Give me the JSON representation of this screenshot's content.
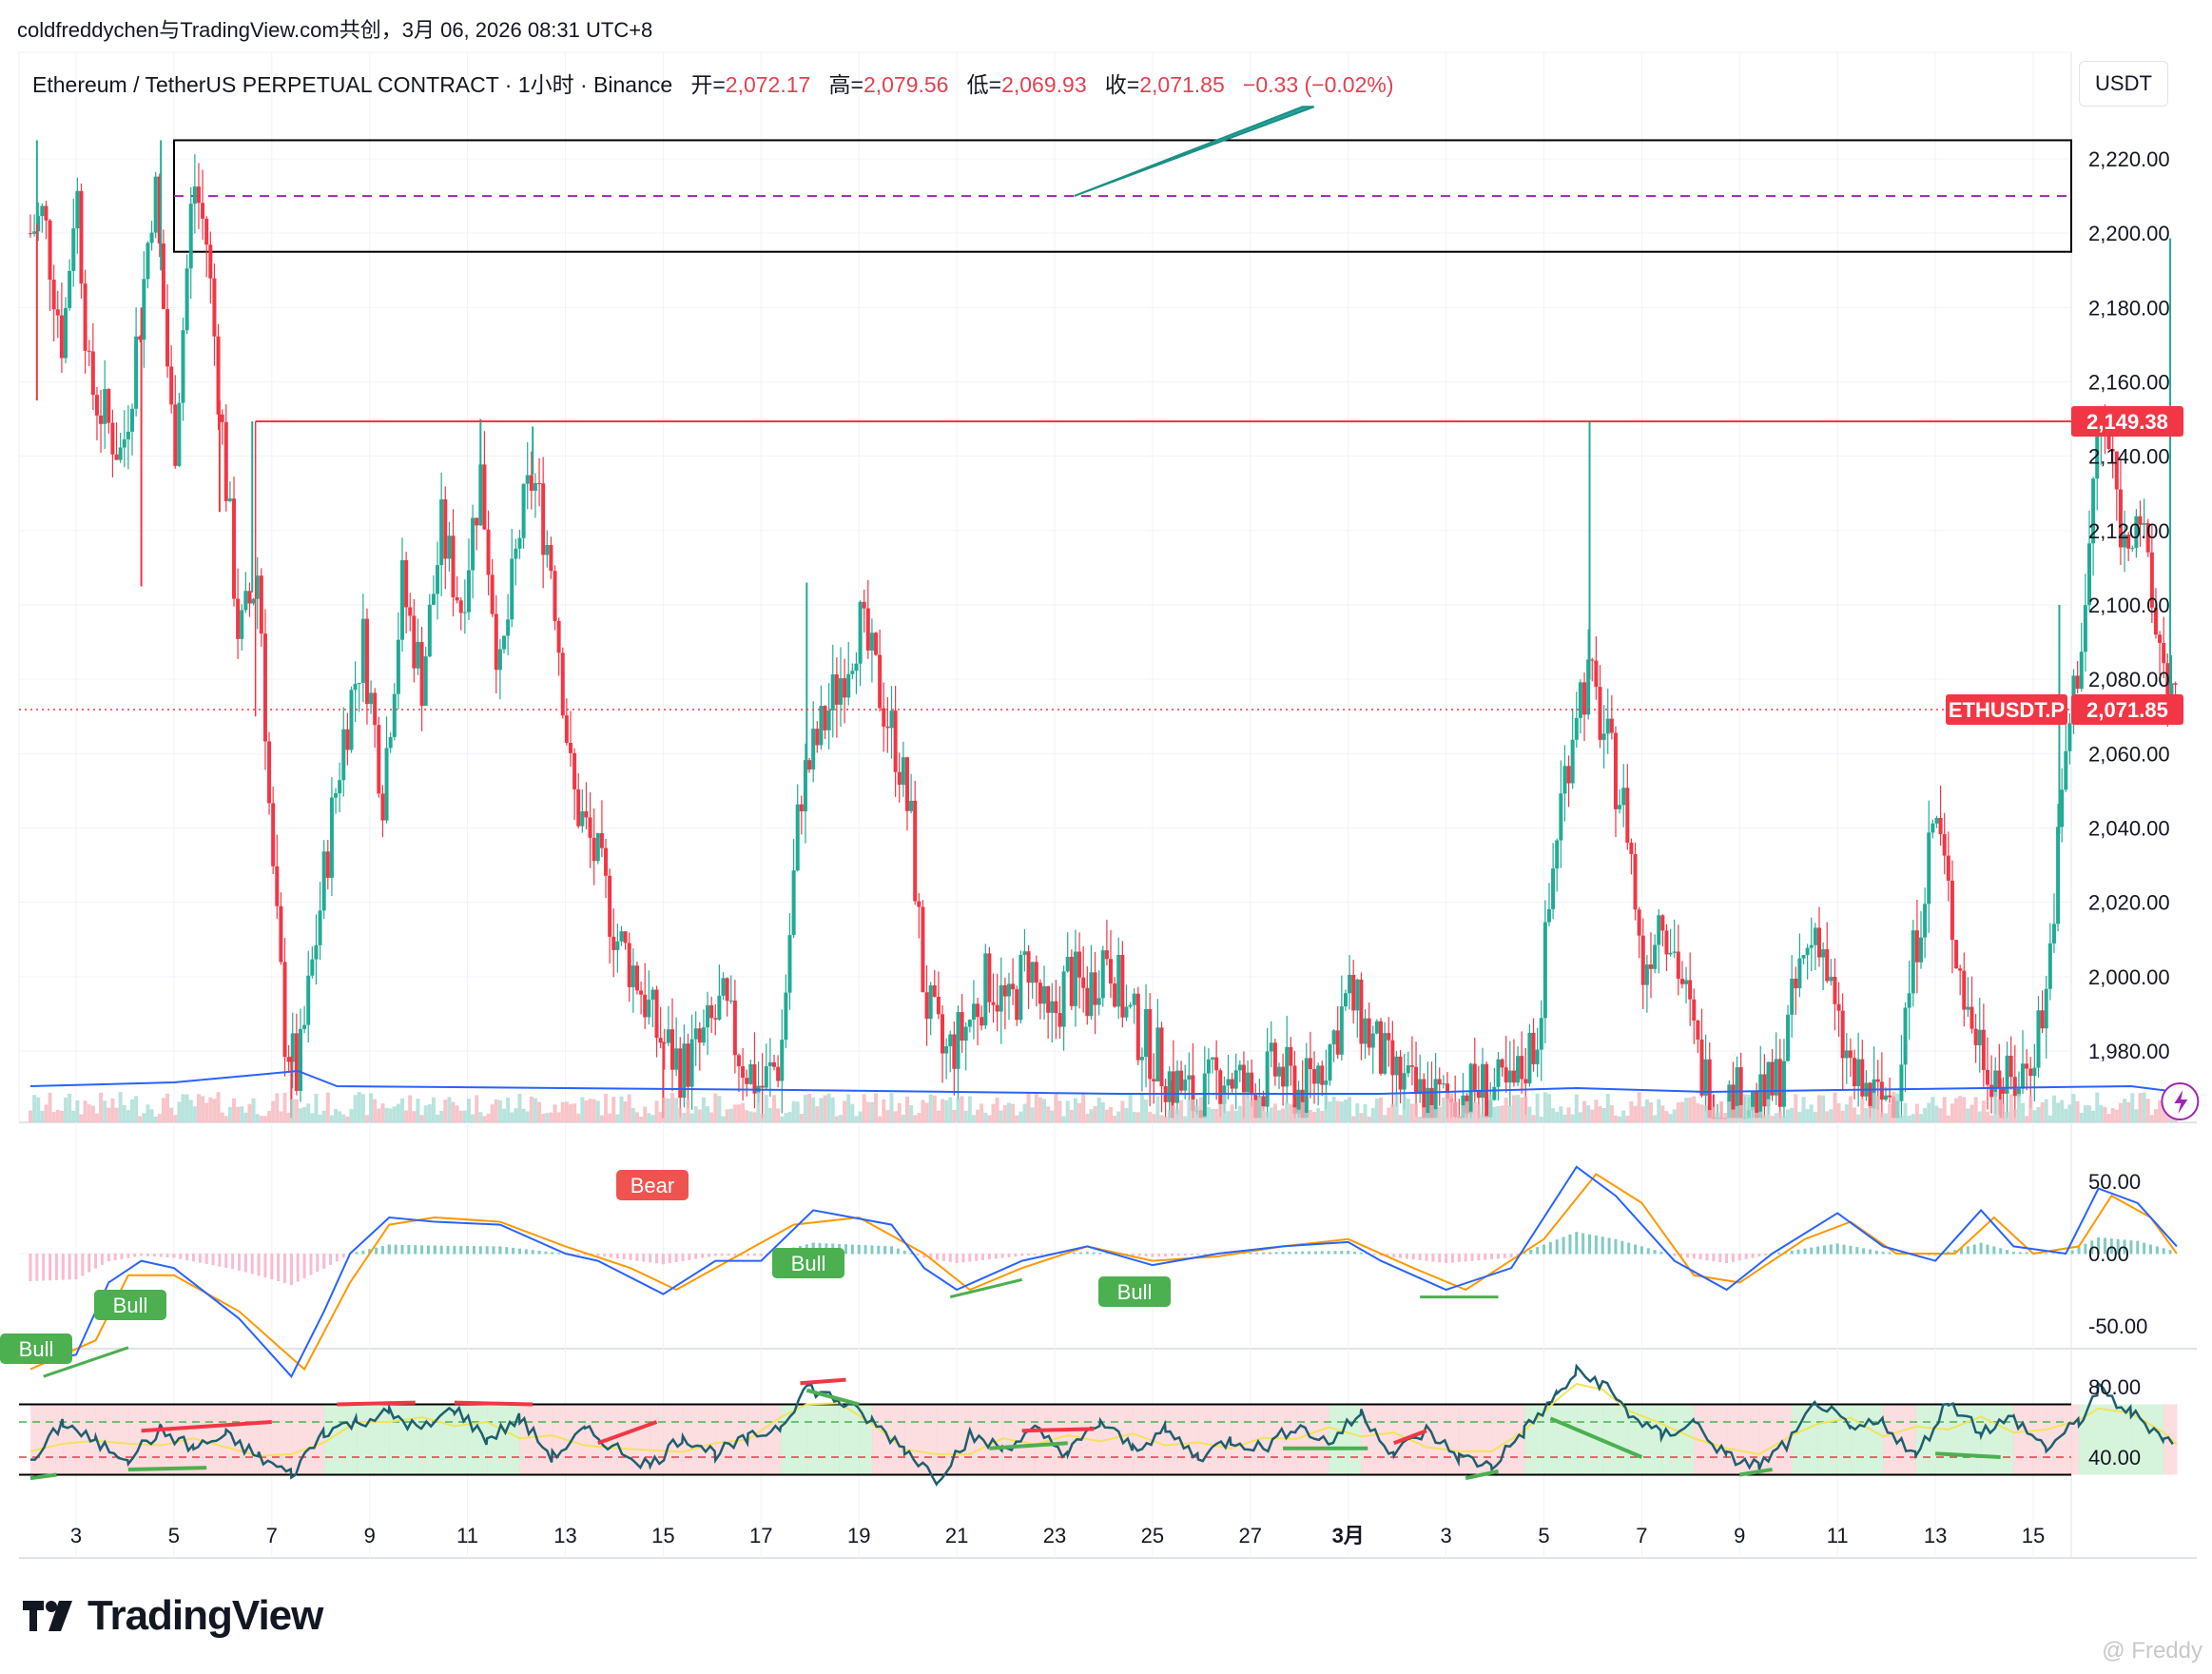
{
  "header": {
    "credit": "coldfreddychen与TradingView.com共创，3月 06, 2026 08:31 UTC+8",
    "symbol_line": "Ethereum / TetherUS PERPETUAL CONTRACT · 1小时 · Binance",
    "open_label": "开=",
    "open": "2,072.17",
    "high_label": "高=",
    "high": "2,079.56",
    "low_label": "低=",
    "low": "2,069.93",
    "close_label": "收=",
    "close": "2,071.85",
    "change": "−0.33 (−0.02%)"
  },
  "unit_button": "USDT",
  "colors": {
    "up": "#22ab94",
    "down": "#f23645",
    "macd": "#2962ff",
    "signal": "#ff9800",
    "rsi": "#1e5f6e",
    "zone_line": "#000000",
    "resistance": "#f23645",
    "dashed": "#9c27b0"
  },
  "chart_data": [
    {
      "type": "candlestick",
      "title": "Ethereum / TetherUS PERPETUAL CONTRACT · 1小时 · Binance",
      "x_tick_labels": [
        "3",
        "5",
        "7",
        "9",
        "11",
        "13",
        "15",
        "17",
        "19",
        "21",
        "23",
        "25",
        "27",
        "3月",
        "3",
        "5",
        "7",
        "9",
        "11",
        "13",
        "15"
      ],
      "y_tick_labels": [
        "2,220.00",
        "2,200.00",
        "2,180.00",
        "2,160.00",
        "2,140.00",
        "2,120.00",
        "2,100.00",
        "2,080.00",
        "2,060.00",
        "2,040.00",
        "2,020.00",
        "2,000.00",
        "1,980.00"
      ],
      "ylim": [
        1962,
        2234
      ],
      "price_path": [
        [
          2.3,
          2200
        ],
        [
          2.5,
          2205
        ],
        [
          2.8,
          2170
        ],
        [
          3.0,
          2215
        ],
        [
          3.2,
          2160
        ],
        [
          3.7,
          2140
        ],
        [
          4.0,
          2180
        ],
        [
          4.2,
          2215
        ],
        [
          4.5,
          2140
        ],
        [
          4.8,
          2215
        ],
        [
          5.0,
          2198
        ],
        [
          5.2,
          2155
        ],
        [
          5.5,
          2090
        ],
        [
          5.8,
          2110
        ],
        [
          6.0,
          2030
        ],
        [
          6.2,
          1985
        ],
        [
          6.4,
          1972
        ],
        [
          6.6,
          2000
        ],
        [
          6.9,
          2040
        ],
        [
          7.1,
          2065
        ],
        [
          7.4,
          2090
        ],
        [
          7.7,
          2050
        ],
        [
          8.0,
          2105
        ],
        [
          8.3,
          2080
        ],
        [
          8.6,
          2120
        ],
        [
          8.9,
          2100
        ],
        [
          9.2,
          2135
        ],
        [
          9.5,
          2080
        ],
        [
          9.8,
          2120
        ],
        [
          10.0,
          2135
        ],
        [
          10.3,
          2110
        ],
        [
          10.6,
          2050
        ],
        [
          11.0,
          2030
        ],
        [
          11.3,
          2010
        ],
        [
          11.6,
          2000
        ],
        [
          11.9,
          1985
        ],
        [
          12.3,
          1975
        ],
        [
          12.6,
          1982
        ],
        [
          12.9,
          1992
        ],
        [
          13.2,
          1978
        ],
        [
          13.5,
          1970
        ],
        [
          13.8,
          1978
        ],
        [
          14.1,
          2050
        ],
        [
          14.4,
          2065
        ],
        [
          14.7,
          2080
        ],
        [
          15.0,
          2095
        ],
        [
          15.3,
          2078
        ],
        [
          15.6,
          2060
        ],
        [
          15.8,
          2040
        ],
        [
          16.0,
          1995
        ],
        [
          16.3,
          1978
        ],
        [
          16.6,
          1985
        ],
        [
          17.0,
          2000
        ],
        [
          17.3,
          1990
        ],
        [
          17.6,
          2005
        ],
        [
          17.9,
          1985
        ],
        [
          18.2,
          2000
        ],
        [
          18.5,
          1995
        ],
        [
          18.8,
          2008
        ],
        [
          19.1,
          1990
        ],
        [
          19.5,
          1980
        ],
        [
          19.8,
          1972
        ],
        [
          20.2,
          1965
        ],
        [
          20.6,
          1975
        ],
        [
          21.0,
          1968
        ],
        [
          21.4,
          1975
        ],
        [
          21.8,
          1968
        ],
        [
          22.2,
          1980
        ],
        [
          22.5,
          1995
        ],
        [
          22.8,
          1985
        ],
        [
          23.1,
          1975
        ],
        [
          23.5,
          1968
        ],
        [
          24.0,
          1966
        ],
        [
          24.5,
          1970
        ],
        [
          25.0,
          1968
        ],
        [
          25.4,
          1985
        ],
        [
          25.7,
          2040
        ],
        [
          26.0,
          2075
        ],
        [
          26.2,
          2080
        ],
        [
          26.5,
          2060
        ],
        [
          26.8,
          2040
        ],
        [
          27.0,
          2000
        ],
        [
          27.3,
          2020
        ],
        [
          27.6,
          2000
        ],
        [
          27.9,
          1975
        ],
        [
          28.2,
          1965
        ],
        [
          28.5,
          1968
        ],
        [
          28.8,
          1965
        ],
        [
          29.1,
          1972
        ],
        [
          29.4,
          2000
        ],
        [
          29.7,
          2015
        ],
        [
          30.0,
          1985
        ],
        [
          30.3,
          1970
        ],
        [
          30.6,
          1966
        ],
        [
          30.9,
          1970
        ],
        [
          31.2,
          2010
        ],
        [
          31.5,
          2045
        ],
        [
          31.8,
          2010
        ],
        [
          32.0,
          1990
        ],
        [
          32.3,
          1978
        ],
        [
          32.6,
          1970
        ],
        [
          32.9,
          1975
        ],
        [
          33.2,
          1995
        ],
        [
          33.5,
          2060
        ],
        [
          33.8,
          2100
        ],
        [
          34.0,
          2150
        ],
        [
          34.2,
          2140
        ],
        [
          34.4,
          2115
        ],
        [
          34.6,
          2130
        ],
        [
          34.8,
          2100
        ],
        [
          35.0,
          2085
        ],
        [
          35.2,
          2072
        ]
      ],
      "spike_highs": [
        [
          2.4,
          2225
        ],
        [
          4.3,
          2225
        ],
        [
          5.7,
          2149.38
        ],
        [
          9.2,
          2150
        ],
        [
          10.0,
          2148
        ],
        [
          14.2,
          2106
        ],
        [
          26.2,
          2149.38
        ],
        [
          33.4,
          2100
        ],
        [
          35.1,
          2198.6
        ]
      ],
      "spike_lows": [
        [
          2.4,
          2155
        ],
        [
          4.0,
          2105
        ],
        [
          5.2,
          2125
        ],
        [
          6.3,
          1962
        ],
        [
          12.0,
          1962
        ],
        [
          19.8,
          1962
        ],
        [
          28.1,
          1962
        ],
        [
          32.5,
          1962
        ]
      ],
      "resistance_label": "2,149.38",
      "last_price_tag": "ETHUSDT.P",
      "last_price": "2,071.85",
      "zone_top": 2225,
      "zone_bottom": 2195,
      "zone_mid_dashed": 2210,
      "volume_moving_average": [
        [
          2.3,
          0.5
        ],
        [
          4.5,
          0.6
        ],
        [
          6.4,
          0.9
        ],
        [
          7.0,
          0.5
        ],
        [
          14.0,
          0.4
        ],
        [
          19.0,
          0.3
        ],
        [
          23.0,
          0.3
        ],
        [
          26.0,
          0.45
        ],
        [
          28.0,
          0.35
        ],
        [
          30.0,
          0.4
        ],
        [
          34.5,
          0.5
        ],
        [
          35.2,
          0.35
        ]
      ],
      "trendline_fragment": [
        [
          18.3,
          2210
        ],
        [
          21.8,
          2234
        ]
      ]
    },
    {
      "type": "line",
      "name": "MACD",
      "y_tick_labels": [
        "50.00",
        "0.00",
        "-50.00"
      ],
      "ylim": [
        -95,
        72
      ],
      "series": [
        {
          "values": [
            [
              2.3,
              -75
            ],
            [
              3.0,
              -70
            ],
            [
              3.5,
              -20
            ],
            [
              4.0,
              -5
            ],
            [
              4.5,
              -10
            ],
            [
              5.5,
              -45
            ],
            [
              6.3,
              -85
            ],
            [
              6.8,
              -40
            ],
            [
              7.2,
              0
            ],
            [
              7.8,
              25
            ],
            [
              8.5,
              22
            ],
            [
              9.5,
              20
            ],
            [
              10.5,
              0
            ],
            [
              11.0,
              -5
            ],
            [
              12.0,
              -28
            ],
            [
              12.8,
              -5
            ],
            [
              13.5,
              -5
            ],
            [
              14.3,
              30
            ],
            [
              15.5,
              20
            ],
            [
              16.0,
              -10
            ],
            [
              16.5,
              -25
            ],
            [
              17.5,
              -5
            ],
            [
              18.5,
              5
            ],
            [
              19.5,
              -8
            ],
            [
              20.5,
              0
            ],
            [
              21.5,
              5
            ],
            [
              22.5,
              8
            ],
            [
              23.0,
              -5
            ],
            [
              24.0,
              -25
            ],
            [
              25.0,
              -10
            ],
            [
              26.0,
              60
            ],
            [
              26.6,
              40
            ],
            [
              27.5,
              -5
            ],
            [
              28.3,
              -25
            ],
            [
              29.0,
              0
            ],
            [
              30.0,
              28
            ],
            [
              30.7,
              5
            ],
            [
              31.5,
              -5
            ],
            [
              32.2,
              30
            ],
            [
              32.7,
              5
            ],
            [
              33.5,
              0
            ],
            [
              34.0,
              45
            ],
            [
              34.6,
              35
            ],
            [
              35.2,
              5
            ]
          ]
        },
        {
          "values": [
            [
              2.3,
              -80
            ],
            [
              3.3,
              -60
            ],
            [
              3.8,
              -15
            ],
            [
              4.5,
              -15
            ],
            [
              5.5,
              -40
            ],
            [
              6.5,
              -80
            ],
            [
              7.2,
              -20
            ],
            [
              7.8,
              20
            ],
            [
              8.5,
              25
            ],
            [
              9.5,
              22
            ],
            [
              10.5,
              5
            ],
            [
              11.5,
              -10
            ],
            [
              12.2,
              -25
            ],
            [
              13.0,
              -5
            ],
            [
              14.0,
              20
            ],
            [
              15.0,
              25
            ],
            [
              16.0,
              0
            ],
            [
              16.7,
              -25
            ],
            [
              17.5,
              -10
            ],
            [
              18.5,
              5
            ],
            [
              19.5,
              -5
            ],
            [
              20.5,
              -2
            ],
            [
              21.5,
              5
            ],
            [
              22.5,
              10
            ],
            [
              23.5,
              -10
            ],
            [
              24.3,
              -25
            ],
            [
              25.5,
              10
            ],
            [
              26.3,
              55
            ],
            [
              27.0,
              35
            ],
            [
              27.8,
              -15
            ],
            [
              28.5,
              -20
            ],
            [
              29.5,
              10
            ],
            [
              30.2,
              22
            ],
            [
              30.9,
              0
            ],
            [
              31.8,
              0
            ],
            [
              32.4,
              25
            ],
            [
              33.0,
              0
            ],
            [
              33.7,
              5
            ],
            [
              34.2,
              40
            ],
            [
              34.8,
              25
            ],
            [
              35.2,
              0
            ]
          ]
        }
      ]
    },
    {
      "type": "line",
      "name": "RSI",
      "y_tick_labels": [
        "80.00",
        "40.00"
      ],
      "ylim": [
        20,
        95
      ],
      "values": [
        [
          2.3,
          35
        ],
        [
          2.8,
          60
        ],
        [
          3.3,
          48
        ],
        [
          3.8,
          40
        ],
        [
          4.3,
          55
        ],
        [
          4.8,
          45
        ],
        [
          5.3,
          52
        ],
        [
          5.8,
          40
        ],
        [
          6.3,
          30
        ],
        [
          6.8,
          55
        ],
        [
          7.3,
          60
        ],
        [
          7.8,
          65
        ],
        [
          8.3,
          55
        ],
        [
          8.8,
          68
        ],
        [
          9.3,
          50
        ],
        [
          9.8,
          62
        ],
        [
          10.3,
          40
        ],
        [
          10.8,
          55
        ],
        [
          11.3,
          45
        ],
        [
          11.8,
          35
        ],
        [
          12.3,
          52
        ],
        [
          12.8,
          42
        ],
        [
          13.3,
          50
        ],
        [
          13.8,
          58
        ],
        [
          14.2,
          80
        ],
        [
          14.7,
          72
        ],
        [
          15.2,
          60
        ],
        [
          15.7,
          45
        ],
        [
          16.2,
          28
        ],
        [
          16.7,
          52
        ],
        [
          17.2,
          45
        ],
        [
          17.7,
          55
        ],
        [
          18.2,
          42
        ],
        [
          18.7,
          60
        ],
        [
          19.2,
          45
        ],
        [
          19.7,
          55
        ],
        [
          20.2,
          40
        ],
        [
          20.7,
          50
        ],
        [
          21.2,
          45
        ],
        [
          21.7,
          58
        ],
        [
          22.2,
          48
        ],
        [
          22.7,
          65
        ],
        [
          23.2,
          42
        ],
        [
          23.7,
          55
        ],
        [
          24.2,
          40
        ],
        [
          24.7,
          35
        ],
        [
          25.2,
          55
        ],
        [
          25.7,
          75
        ],
        [
          26.0,
          88
        ],
        [
          26.4,
          82
        ],
        [
          26.8,
          65
        ],
        [
          27.3,
          52
        ],
        [
          27.8,
          60
        ],
        [
          28.3,
          40
        ],
        [
          28.8,
          35
        ],
        [
          29.3,
          50
        ],
        [
          29.7,
          72
        ],
        [
          30.2,
          55
        ],
        [
          30.7,
          60
        ],
        [
          31.2,
          40
        ],
        [
          31.7,
          72
        ],
        [
          32.2,
          55
        ],
        [
          32.7,
          62
        ],
        [
          33.2,
          45
        ],
        [
          33.7,
          60
        ],
        [
          34.0,
          78
        ],
        [
          34.5,
          65
        ],
        [
          35.0,
          52
        ],
        [
          35.2,
          45
        ]
      ],
      "level_lines": [
        70,
        30
      ],
      "dashed_levels": [
        60,
        40
      ]
    }
  ],
  "labels": {
    "bear": "Bear",
    "bull_1": "Bull",
    "bull_2": "Bull",
    "bull_3": "Bull",
    "bull_4": "Bull"
  },
  "brand": "TradingView",
  "watermark": "@ Freddy"
}
